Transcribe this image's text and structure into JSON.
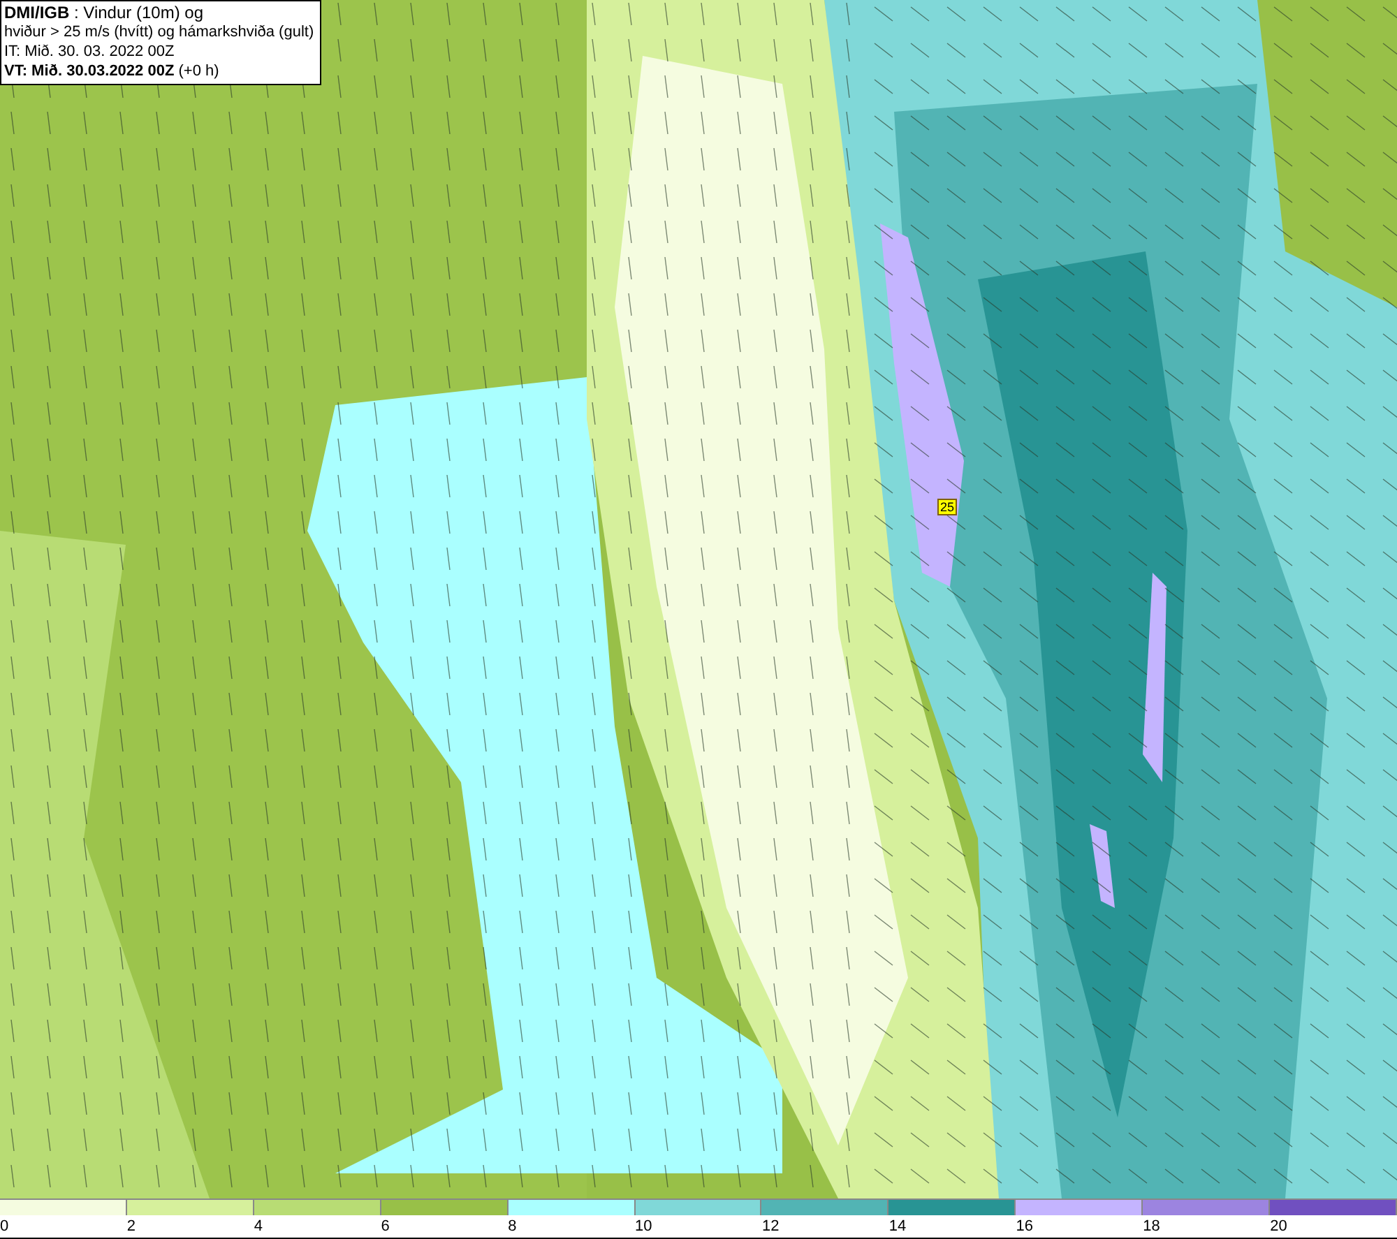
{
  "title_box": {
    "lines": [
      "**DMI/IGB** : Vindur (10m) og",
      "hviður > 25 m/s (hvítt) og hámarkshviða (gult)",
      "IT: Mið. 30. 03. 2022 00Z",
      "**VT: Mið. 30.03.2022 00Z** (+0 h)"
    ]
  },
  "map": {
    "gust_label": "25"
  },
  "legend": [
    {
      "label": "0",
      "color": "#f5fce0"
    },
    {
      "label": "2",
      "color": "#d6f09c"
    },
    {
      "label": "4",
      "color": "#b8dc74"
    },
    {
      "label": "6",
      "color": "#98c048"
    },
    {
      "label": "8",
      "color": "#aaffff"
    },
    {
      "label": "10",
      "color": "#80d8d8"
    },
    {
      "label": "12",
      "color": "#52b4b4"
    },
    {
      "label": "14",
      "color": "#289494"
    },
    {
      "label": "16",
      "color": "#c4b4ff"
    },
    {
      "label": "18",
      "color": "#9c84e0"
    },
    {
      "label": "20",
      "color": "#7050c0"
    }
  ]
}
